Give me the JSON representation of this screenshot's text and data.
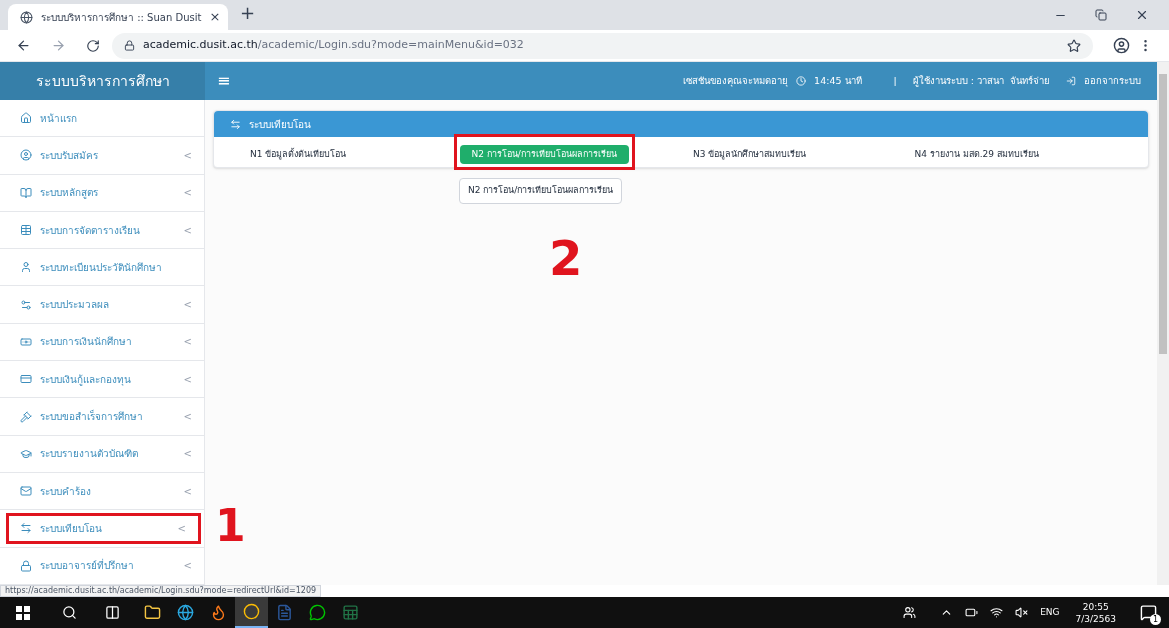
{
  "browser": {
    "tab_title": "ระบบบริหารการศึกษา :: Suan Dusit",
    "tab_close": "×",
    "new_tab": "+",
    "url_domain": "academic.dusit.ac.th",
    "url_path": "/academic/Login.sdu?mode=mainMenu&id=032"
  },
  "header": {
    "brand": "ระบบบริหารการศึกษา",
    "menu_toggle": "≡",
    "session_label": "เซสชันของคุณจะหมดอายุ",
    "session_time": "14:45 นาที",
    "separator": "|",
    "user": "ผู้ใช้งานระบบ : วาสนา  จันทร์จ่าย",
    "logout": "ออกจากระบบ"
  },
  "sidebar": {
    "items": [
      {
        "label": "หน้าแรก",
        "highlighted": false
      },
      {
        "label": "ระบบรับสมัคร",
        "caret": "<",
        "highlighted": false
      },
      {
        "label": "ระบบหลักสูตร",
        "caret": "<",
        "highlighted": false
      },
      {
        "label": "ระบบการจัดตารางเรียน",
        "caret": "<",
        "highlighted": false
      },
      {
        "label": "ระบบทะเบียนประวัตินักศึกษา",
        "highlighted": false
      },
      {
        "label": "ระบบประมวลผล",
        "caret": "<",
        "highlighted": false
      },
      {
        "label": "ระบบการเงินนักศึกษา",
        "caret": "<",
        "highlighted": false
      },
      {
        "label": "ระบบเงินกู้และกองทุน",
        "caret": "<",
        "highlighted": false
      },
      {
        "label": "ระบบขอสำเร็จการศึกษา",
        "caret": "<",
        "highlighted": false
      },
      {
        "label": "ระบบรายงานตัวบัณฑิต",
        "caret": "<",
        "highlighted": false
      },
      {
        "label": "ระบบคำร้อง",
        "caret": "<",
        "highlighted": false
      },
      {
        "label": "ระบบเทียบโอน",
        "caret": "<",
        "highlighted": true,
        "step": "1"
      },
      {
        "label": "ระบบอาจารย์ที่ปรึกษา",
        "caret": "<",
        "highlighted": false
      }
    ]
  },
  "panel": {
    "title": "ระบบเทียบโอน",
    "tabs": [
      {
        "label": "N1 ข้อมูลตั้งต้นเทียบโอน",
        "selected": false,
        "highlighted": false
      },
      {
        "label": "N2 การโอน/การเทียบโอนผลการเรียน",
        "selected": true,
        "highlighted": true
      },
      {
        "label": "N3 ข้อมูลนักศึกษาสมทบเรียน",
        "selected": false,
        "highlighted": false
      },
      {
        "label": "N4 รายงาน มสด.29 สมทบเรียน",
        "selected": false,
        "highlighted": false
      }
    ],
    "tooltip": "N2 การโอน/การเทียบโอนผลการเรียน",
    "step": "2"
  },
  "status_url": "https://academic.dusit.ac.th/academic/Login.sdu?mode=redirectUrl&id=1209",
  "taskbar": {
    "apps": [
      {
        "active": false
      },
      {
        "active": false
      },
      {
        "active": false
      },
      {
        "active": true
      },
      {
        "active": false
      },
      {
        "active": false
      },
      {
        "active": false
      }
    ],
    "language": "ENG",
    "time": "20:55",
    "date": "7/3/2563",
    "notifications": "1"
  }
}
